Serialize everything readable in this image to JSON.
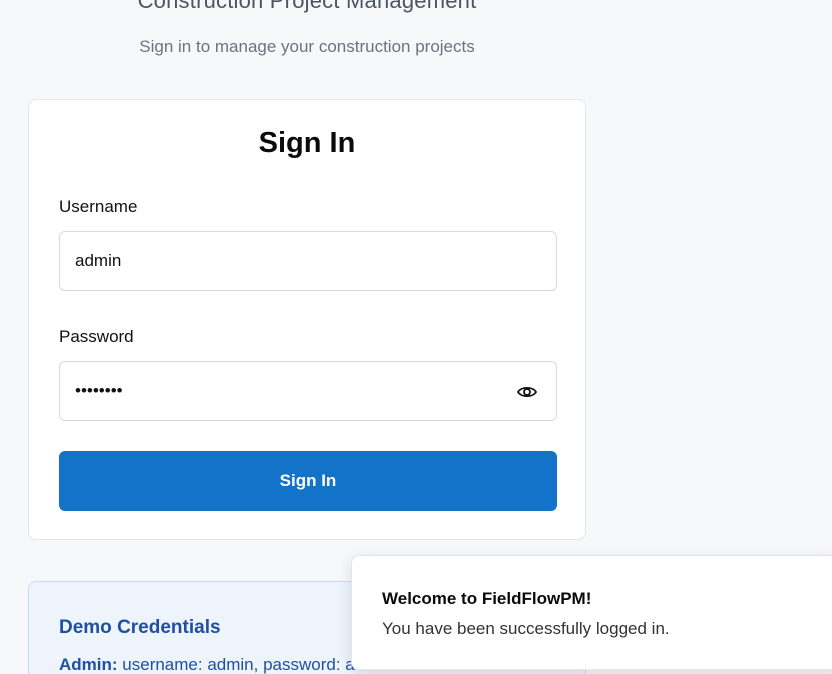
{
  "header": {
    "title": "Construction Project Management",
    "subtitle": "Sign in to manage your construction projects"
  },
  "signin_card": {
    "title": "Sign In",
    "username_label": "Username",
    "username_value": "admin",
    "password_label": "Password",
    "password_value": "••••••••",
    "toggle_icon": "eye-icon",
    "submit_label": "Sign In"
  },
  "demo": {
    "title": "Demo Credentials",
    "role": "Admin:",
    "details": "username: admin, password: a"
  },
  "toast": {
    "title": "Welcome to FieldFlowPM!",
    "message": "You have been successfully logged in."
  },
  "colors": {
    "primary": "#1273c8",
    "demo_text": "#1f4fa3",
    "background": "#f7f8fa"
  }
}
